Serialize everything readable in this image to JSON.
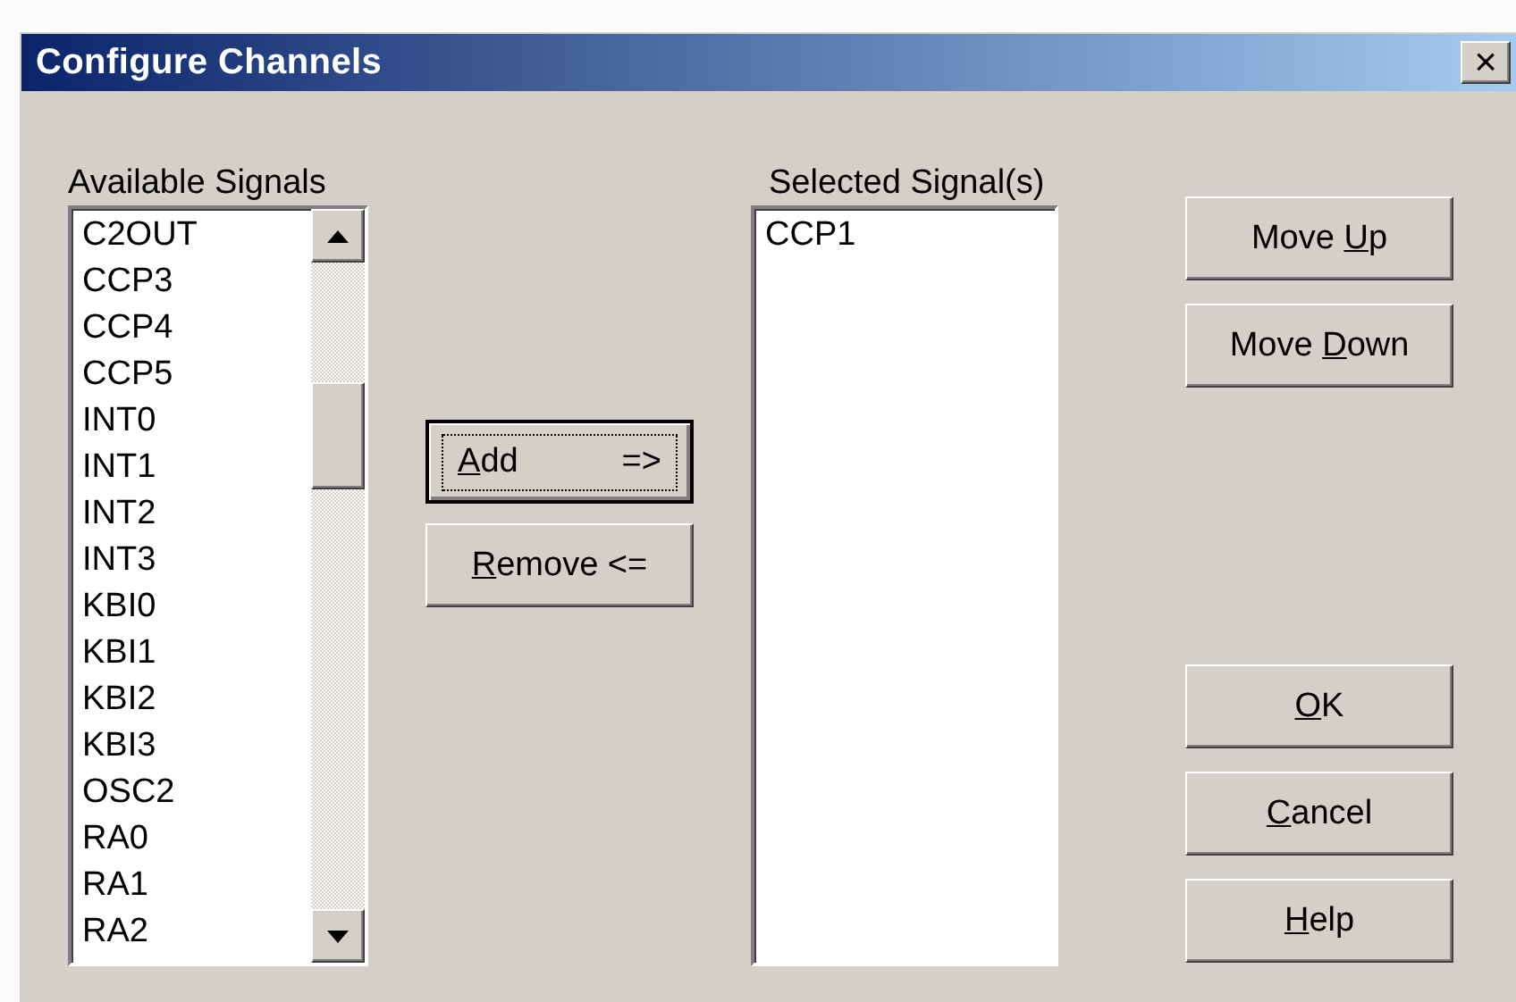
{
  "window": {
    "title": "Configure Channels",
    "close_label": "×"
  },
  "available": {
    "label": "Available Signals",
    "items": [
      "C2OUT",
      "CCP3",
      "CCP4",
      "CCP5",
      "INT0",
      "INT1",
      "INT2",
      "INT3",
      "KBI0",
      "KBI1",
      "KBI2",
      "KBI3",
      "OSC2",
      "RA0",
      "RA1",
      "RA2"
    ]
  },
  "transfer_buttons": [
    {
      "label": [
        {
          "text": "A",
          "underline": true
        },
        {
          "text": "dd"
        }
      ],
      "arrow": "=>",
      "focused": true
    },
    {
      "label": [
        {
          "text": "R",
          "underline": true
        },
        {
          "text": "emove <="
        }
      ],
      "focused": false
    }
  ],
  "selected": {
    "label": "Selected Signal(s)",
    "items": [
      "CCP1"
    ]
  },
  "order_buttons": [
    {
      "label": [
        {
          "text": "Move "
        },
        {
          "text": "U",
          "underline": true
        },
        {
          "text": "p"
        }
      ],
      "focused": false
    },
    {
      "label": [
        {
          "text": "Move "
        },
        {
          "text": "D",
          "underline": true
        },
        {
          "text": "own"
        }
      ],
      "focused": false
    }
  ],
  "dialog_buttons": [
    {
      "label": [
        {
          "text": "O",
          "underline": true
        },
        {
          "text": "K"
        }
      ],
      "focused": false
    },
    {
      "label": [
        {
          "text": "C",
          "underline": true
        },
        {
          "text": "ancel"
        }
      ],
      "focused": false
    },
    {
      "label": [
        {
          "text": "H",
          "underline": true
        },
        {
          "text": "elp"
        }
      ],
      "focused": false
    }
  ]
}
